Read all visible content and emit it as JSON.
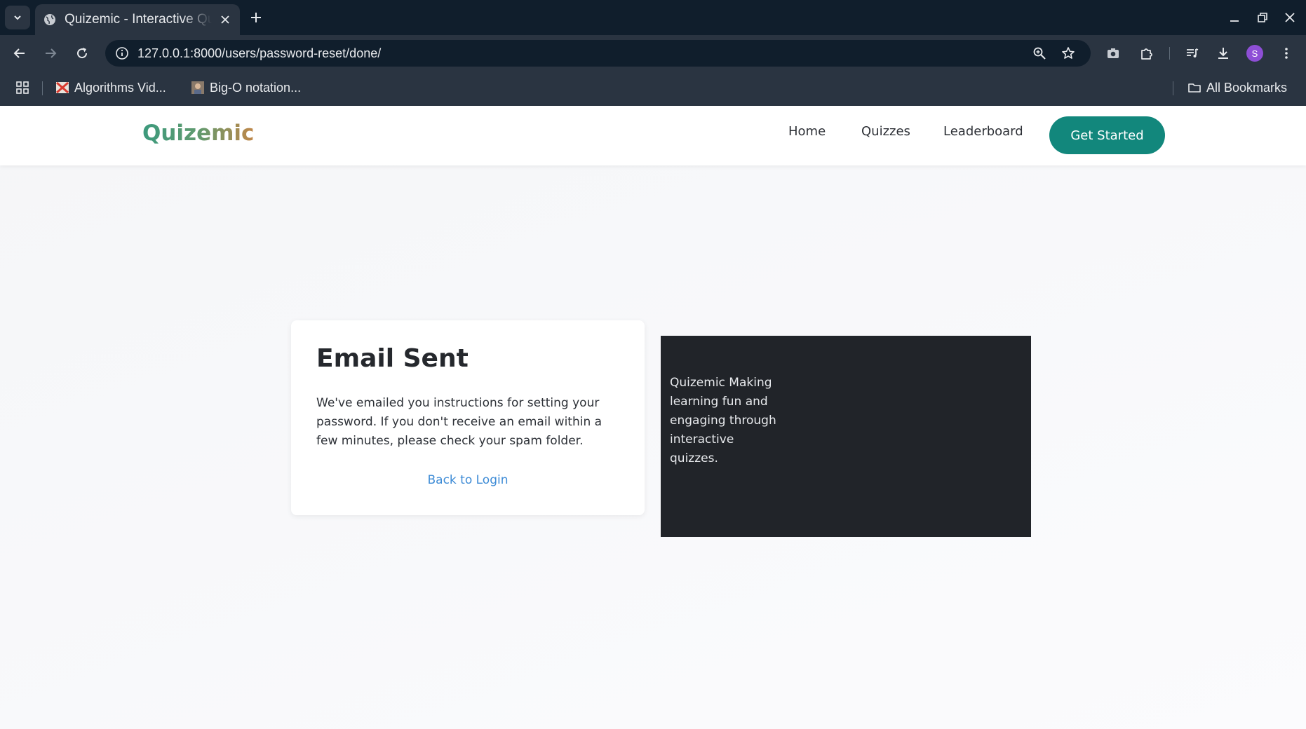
{
  "browser": {
    "tab_title": "Quizemic - Interactive Quiz",
    "url": "127.0.0.1:8000/users/password-reset/done/",
    "profile_initial": "S",
    "bookmarks": [
      {
        "label": "Algorithms Vid..."
      },
      {
        "label": "Big-O notation..."
      }
    ],
    "all_bookmarks_label": "All Bookmarks"
  },
  "navbar": {
    "brand": "Quizemic",
    "links": [
      "Home",
      "Quizzes",
      "Leaderboard"
    ],
    "cta_label": "Get Started"
  },
  "card": {
    "title": "Email Sent",
    "body": "We've emailed you instructions for setting your password. If you don't receive an email within a few minutes, please check your spam folder.",
    "link_label": "Back to Login"
  },
  "panel": {
    "text": "Quizemic Making learning fun and engaging through interactive quizzes."
  },
  "colors": {
    "chrome_dark": "#101e2c",
    "chrome_toolbar": "#2a3441",
    "brand_teal": "#12877c",
    "link_blue": "#3d8bd6",
    "panel_dark": "#212429"
  }
}
